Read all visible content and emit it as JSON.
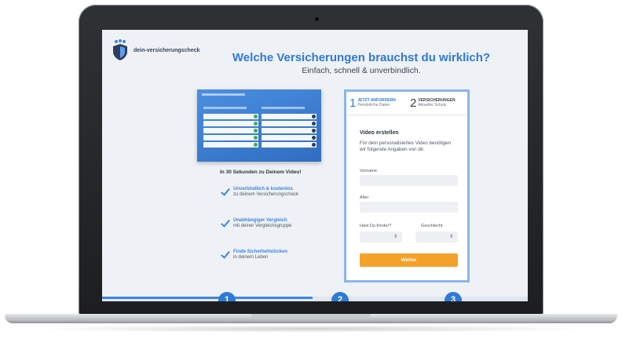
{
  "brand": {
    "name": "dein-versicherungscheck",
    "color": "#2f7ad8"
  },
  "hero": {
    "title": "Welche Versicherungen brauchst du wirklich?",
    "subtitle": "Einfach, schnell & unverbindlich."
  },
  "left": {
    "video_title": "In 30 Sekunden zu Deinem Video!",
    "features": [
      {
        "title": "Unverbindlich & kostenlos",
        "sub": "zu deinem Versicherungscheck"
      },
      {
        "title": "Unabhängiger Vergleich",
        "sub": "mit deiner Vergleichsgruppe"
      },
      {
        "title": "Finde Sicherheitslücken",
        "sub": "in deinem Leben"
      }
    ]
  },
  "steps": [
    {
      "num": "1",
      "title": "JETZT ANFORDERN",
      "sub": "Persönliche Daten"
    },
    {
      "num": "2",
      "title": "VERSICHERUNGEN",
      "sub": "Aktueller Schutz"
    }
  ],
  "form": {
    "title": "Video erstellen",
    "description": "Für dein personalisiertes Video benötigen wir folgende Angaben von dir.",
    "fields": {
      "name_label": "Vorname",
      "age_label": "Alter",
      "kids_label": "Hast Du Kinder?",
      "gender_label": "Geschlecht"
    },
    "submit_label": "Weiter",
    "accent": "#f4a129"
  },
  "bottom_steps": [
    "1",
    "2",
    "3"
  ]
}
